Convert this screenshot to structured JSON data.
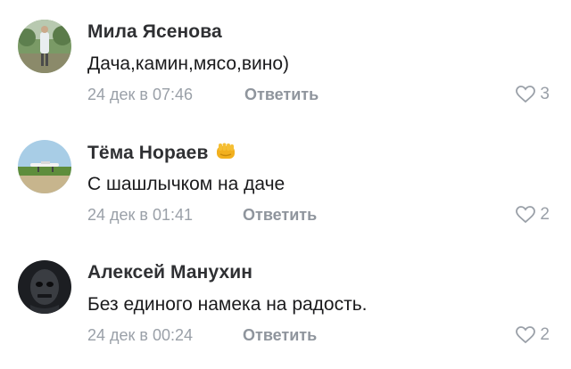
{
  "comments": [
    {
      "author": "Мила Ясенова",
      "text": "Дача,камин,мясо,вино)",
      "date": "24 дек в 07:46",
      "reply_label": "Ответить",
      "likes": "3",
      "avatar_icon": "photo-person-outdoor"
    },
    {
      "author": "Тёма Нораев",
      "badge_icon": "fist-emoji-icon",
      "text": "С шашлычком на даче",
      "date": "24 дек в 01:41",
      "reply_label": "Ответить",
      "likes": "2",
      "avatar_icon": "photo-airplane-field"
    },
    {
      "author": "Алексей Манухин",
      "text": "Без единого намека на радость.",
      "date": "24 дек в 00:24",
      "reply_label": "Ответить",
      "likes": "2",
      "avatar_icon": "photo-dark-mask"
    }
  ],
  "colors": {
    "name": "#2f3033",
    "text": "#1a1a1c",
    "meta": "#9aa0a8",
    "reply": "#8f959d"
  }
}
